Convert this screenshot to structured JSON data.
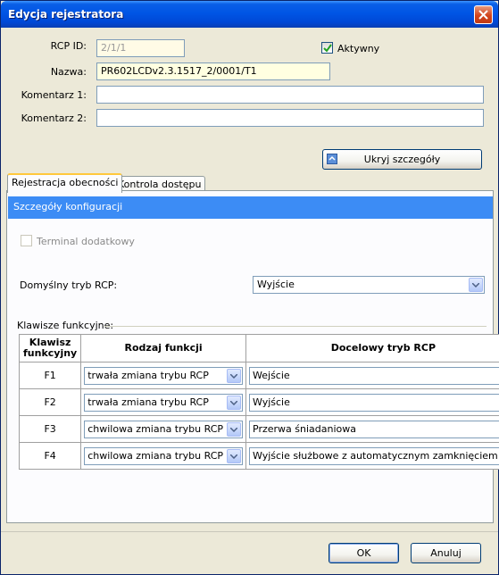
{
  "window": {
    "title": "Edycja rejestratora"
  },
  "form": {
    "rcp_id_label": "RCP ID:",
    "rcp_id_value": "2/1/1",
    "name_label": "Nazwa:",
    "name_value": "PR602LCDv2.3.1517_2/0001/T1",
    "comment1_label": "Komentarz 1:",
    "comment1_value": "",
    "comment2_label": "Komentarz 2:",
    "comment2_value": "",
    "active_label": "Aktywny",
    "active_checked": true,
    "hide_details_label": "Ukryj szczegóły"
  },
  "tabs": [
    {
      "label": "Rejestracja obecności",
      "active": true
    },
    {
      "label": "Kontrola dostępu",
      "active": false
    }
  ],
  "config": {
    "section_title": "Szczegóły konfiguracji",
    "extra_terminal_label": "Terminal dodatkowy",
    "default_mode_label": "Domyślny tryb RCP:",
    "default_mode_value": "Wyjście",
    "function_keys_label": "Klawisze funkcyjne:"
  },
  "function_table": {
    "headers": {
      "key": "Klawisz funkcyjny",
      "type": "Rodzaj funkcji",
      "target": "Docelowy tryb RCP"
    },
    "rows": [
      {
        "key": "F1",
        "type": "trwała zmiana trybu RCP",
        "target": "Wejście"
      },
      {
        "key": "F2",
        "type": "trwała zmiana trybu RCP",
        "target": "Wyjście"
      },
      {
        "key": "F3",
        "type": "chwilowa zmiana trybu RCP",
        "target": "Przerwa śniadaniowa"
      },
      {
        "key": "F4",
        "type": "chwilowa zmiana trybu RCP",
        "target": "Wyjście służbowe z automatycznym zamknięciem"
      }
    ]
  },
  "footer": {
    "ok_label": "OK",
    "cancel_label": "Anuluj"
  }
}
